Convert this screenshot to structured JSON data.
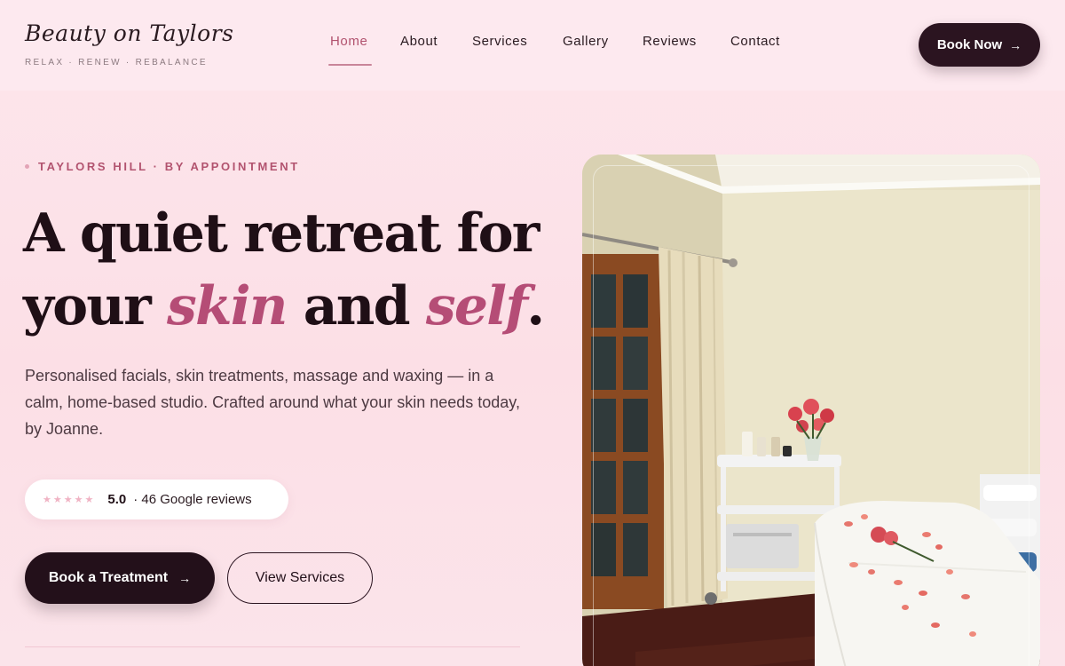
{
  "brand": {
    "name": "Beauty on Taylors",
    "tagline": "RELAX · RENEW · REBALANCE"
  },
  "nav": {
    "items": [
      {
        "label": "Home",
        "active": true
      },
      {
        "label": "About"
      },
      {
        "label": "Services"
      },
      {
        "label": "Gallery"
      },
      {
        "label": "Reviews"
      },
      {
        "label": "Contact"
      }
    ],
    "cta_label": "Book Now",
    "cta_icon": "arrow-right-icon"
  },
  "hero": {
    "eyebrow": "TAYLORS HILL · BY APPOINTMENT",
    "headline": {
      "line1": "A quiet retreat for",
      "word_your": "your",
      "accent1": "skin",
      "word_and": "and",
      "accent2": "self",
      "period": "."
    },
    "lead": "Personalised facials, skin treatments, massage and waxing — in a calm, home-based studio. Crafted around what your skin needs today, by Joanne.",
    "rating": {
      "stars": 5,
      "score": "5.0",
      "count_text": "· 46 Google reviews"
    },
    "primary_button": "Book a Treatment",
    "secondary_button": "View Services",
    "image": "treatment-room-photo"
  },
  "colors": {
    "accent": "#b54d76",
    "accent_soft": "#b2536f",
    "dark": "#23101a",
    "background": "#fde6ec",
    "star": "#f0b3c4"
  }
}
